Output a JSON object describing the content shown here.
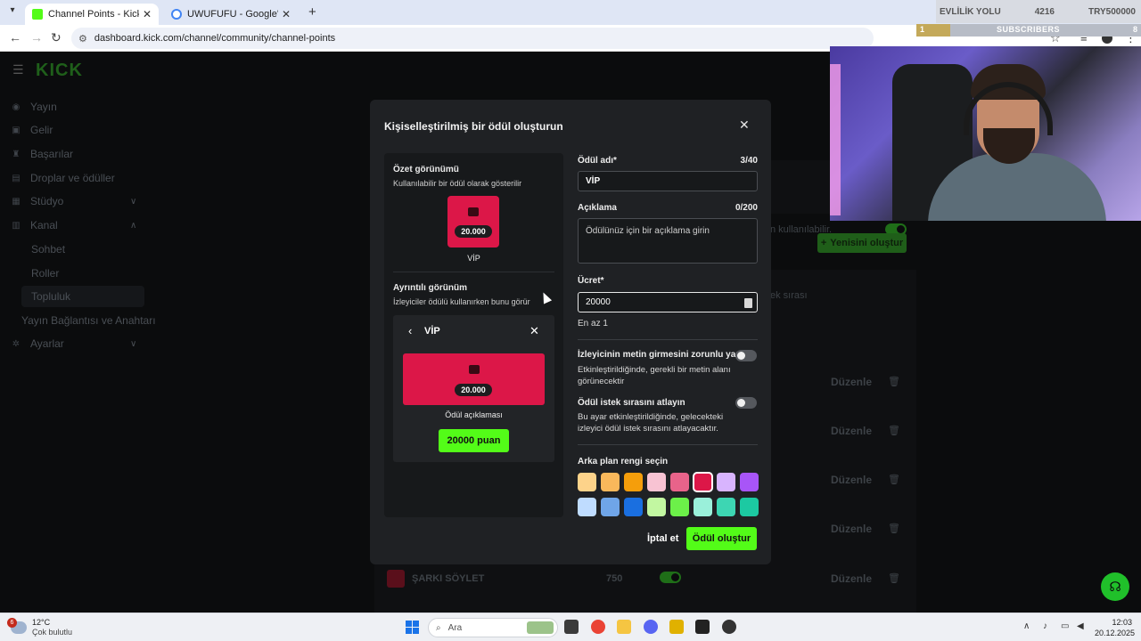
{
  "browser": {
    "tabs": [
      {
        "title": "Channel Points - Kick Dashboard",
        "active": true
      },
      {
        "title": "UWUFUFU - Google'da Ara",
        "active": false
      }
    ],
    "url": "dashboard.kick.com/channel/community/channel-points"
  },
  "stream_overlay": {
    "goal_label": "EVLİLİK YOLU",
    "goal_count": "4216",
    "goal_target": "TRY500000",
    "sub_current": "1",
    "sub_label": "SUBSCRIBERS",
    "sub_goal": "8",
    "sub_progress": 0.15
  },
  "sidebar": {
    "logo": "KICK",
    "items": [
      {
        "label": "Yayın",
        "icon": "broadcast-icon"
      },
      {
        "label": "Gelir",
        "icon": "revenue-icon"
      },
      {
        "label": "Başarılar",
        "icon": "trophy-icon"
      },
      {
        "label": "Droplar ve ödüller",
        "icon": "gift-icon"
      },
      {
        "label": "Stüdyo",
        "icon": "studio-icon"
      },
      {
        "label": "Kanal",
        "icon": "channel-icon"
      }
    ],
    "kanal_sub": [
      "Sohbet",
      "Roller",
      "Topluluk"
    ],
    "extra": "Yayın Bağlantısı ve Anahtarı",
    "settings": "Ayarlar"
  },
  "background": {
    "usable_text": "n kullanılabilir.",
    "queue_text": "ek sırası",
    "new_button": "Yenisini oluştur",
    "edit_label": "Düzenle",
    "song_reward": "ŞARKI SÖYLET",
    "song_cost": "750"
  },
  "modal": {
    "title": "Kişiselleştirilmiş bir ödül oluşturun",
    "summary_title": "Özet görünümü",
    "summary_sub": "Kullanılabilir bir ödül olarak gösterilir",
    "reward_cost": "20.000",
    "reward_name": "VİP",
    "detail_title": "Ayrıntılı görünüm",
    "detail_sub": "İzleyiciler ödülü kullanırken bunu görür",
    "reward_desc": "Ödül açıklaması",
    "points_button": "20000 puan",
    "name_label": "Ödül adı*",
    "name_count": "3/40",
    "name_value": "VİP",
    "desc_label": "Açıklama",
    "desc_count": "0/200",
    "desc_placeholder": "Ödülünüz için bir açıklama girin",
    "cost_label": "Ücret*",
    "cost_value": "20000",
    "cost_help": "En az 1",
    "require_text_label": "İzleyicinin metin girmesini zorunlu yap",
    "require_text_desc": "Etkinleştirildiğinde, gerekli bir metin alanı görünecektir",
    "skip_queue_label": "Ödül istek sırasını atlayın",
    "skip_queue_desc": "Bu ayar etkinleştirildiğinde, gelecekteki izleyici ödül istek sırasını atlayacaktır.",
    "color_label": "Arka plan rengi seçin",
    "colors_row1": [
      "#fdd38a",
      "#f9b85b",
      "#f59e0b",
      "#f8c3d3",
      "#e8638a",
      "#dc1748",
      "#d8b4fe",
      "#a855f7"
    ],
    "colors_row2": [
      "#bfdcff",
      "#6fa5e8",
      "#1a6fe0",
      "#c2f7a1",
      "#6cf049",
      "#9af0da",
      "#3dd6b3",
      "#1cc9a2"
    ],
    "selected_color": "#dc1748",
    "cancel_label": "İptal et",
    "create_label": "Ödül oluştur"
  },
  "taskbar": {
    "temp": "12°C",
    "weather": "Çok bulutlu",
    "weather_badge": "6",
    "search_placeholder": "Ara",
    "time": "12:03",
    "date": "20.12.2025"
  }
}
